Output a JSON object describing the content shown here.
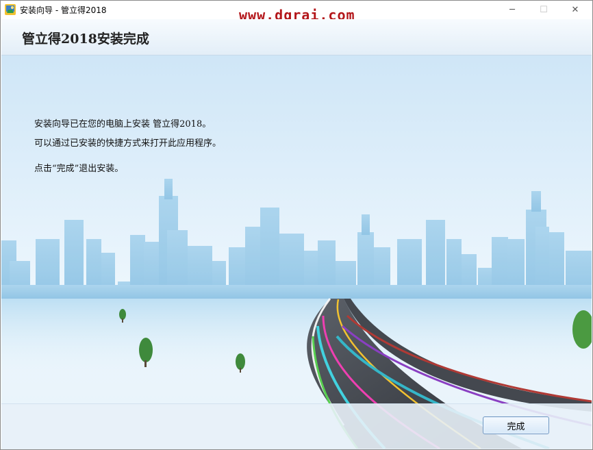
{
  "window": {
    "title": "安装向导 - 管立得2018",
    "watermark": "www.dgrai.com",
    "controls": {
      "minimize": "─",
      "maximize": "☐",
      "close": "✕"
    }
  },
  "header": {
    "title": "管立得2018安装完成"
  },
  "content": {
    "line1": "安装向导已在您的电脑上安装 管立得2018。",
    "line2": "可以通过已安装的快捷方式来打开此应用程序。",
    "line3": "点击“完成”退出安装。"
  },
  "buttons": {
    "finish": "完成"
  },
  "colors": {
    "watermark": "#b3161a",
    "header_bg": "#eef5fb",
    "sky": "#d6ebf9",
    "buildings": "#9fcde8",
    "road": "#3a3e45"
  },
  "icons": {
    "app": "installer-app-icon"
  }
}
